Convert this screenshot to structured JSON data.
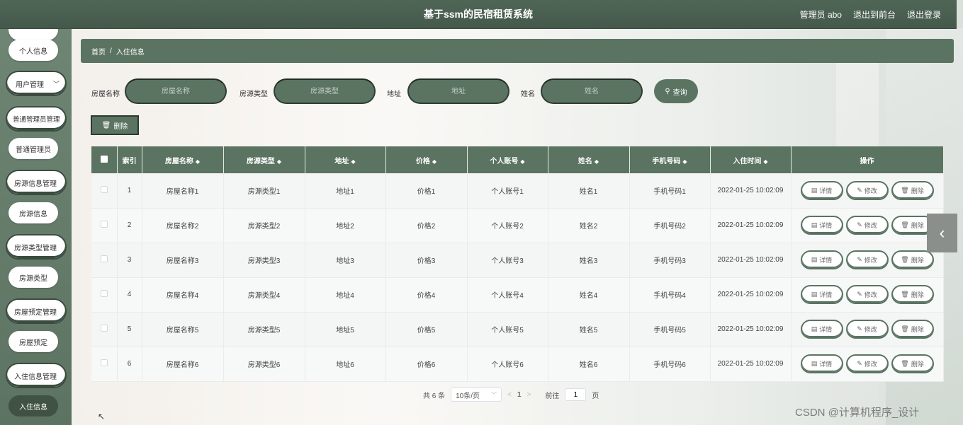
{
  "header": {
    "title": "基于ssm的民宿租赁系统",
    "admin_label": "管理员 abo",
    "to_front": "退出到前台",
    "logout": "退出登录"
  },
  "sidebar": {
    "items": [
      {
        "label": "",
        "kind": "pill"
      },
      {
        "label": "个人信息",
        "kind": "pill"
      },
      {
        "label": "用户管理",
        "kind": "group"
      },
      {
        "label": "普通管理员管理",
        "kind": "group"
      },
      {
        "label": "普通管理员",
        "kind": "pill"
      },
      {
        "label": "房源信息管理",
        "kind": "group"
      },
      {
        "label": "房源信息",
        "kind": "pill"
      },
      {
        "label": "房源类型管理",
        "kind": "group"
      },
      {
        "label": "房源类型",
        "kind": "pill"
      },
      {
        "label": "房屋预定管理",
        "kind": "group"
      },
      {
        "label": "房屋预定",
        "kind": "pill"
      },
      {
        "label": "入住信息管理",
        "kind": "group"
      },
      {
        "label": "入住信息",
        "kind": "active"
      }
    ]
  },
  "breadcrumb": {
    "home": "首页",
    "sep": "/",
    "current": "入住信息"
  },
  "search": {
    "house_label": "房屋名称",
    "house_placeholder": "房屋名称",
    "type_label": "房源类型",
    "type_placeholder": "房源类型",
    "addr_label": "地址",
    "addr_placeholder": "地址",
    "name_label": "姓名",
    "name_placeholder": "姓名",
    "query_label": "查询"
  },
  "actions": {
    "delete_label": "删除"
  },
  "table": {
    "headers": [
      "索引",
      "房屋名称",
      "房源类型",
      "地址",
      "价格",
      "个人账号",
      "姓名",
      "手机号码",
      "入住时间",
      "操作"
    ],
    "sort_mark": "◆",
    "rows": [
      [
        "1",
        "房屋名称1",
        "房源类型1",
        "地址1",
        "价格1",
        "个人账号1",
        "姓名1",
        "手机号码1",
        "2022-01-25 10:02:09"
      ],
      [
        "2",
        "房屋名称2",
        "房源类型2",
        "地址2",
        "价格2",
        "个人账号2",
        "姓名2",
        "手机号码2",
        "2022-01-25 10:02:09"
      ],
      [
        "3",
        "房屋名称3",
        "房源类型3",
        "地址3",
        "价格3",
        "个人账号3",
        "姓名3",
        "手机号码3",
        "2022-01-25 10:02:09"
      ],
      [
        "4",
        "房屋名称4",
        "房源类型4",
        "地址4",
        "价格4",
        "个人账号4",
        "姓名4",
        "手机号码4",
        "2022-01-25 10:02:09"
      ],
      [
        "5",
        "房屋名称5",
        "房源类型5",
        "地址5",
        "价格5",
        "个人账号5",
        "姓名5",
        "手机号码5",
        "2022-01-25 10:02:09"
      ],
      [
        "6",
        "房屋名称6",
        "房源类型6",
        "地址6",
        "价格6",
        "个人账号6",
        "姓名6",
        "手机号码6",
        "2022-01-25 10:02:09"
      ]
    ],
    "ops": {
      "detail": "详情",
      "edit": "修改",
      "delete": "删除"
    }
  },
  "pagination": {
    "total": "共 6 条",
    "page_size": "10条/页",
    "prev": "<",
    "current": "1",
    "next": ">",
    "goto_label": "前往",
    "goto_value": "1",
    "page_suffix": "页"
  },
  "watermark": "CSDN @计算机程序_设计",
  "colors": {
    "primary": "#5b7462",
    "header": "#4f6657",
    "sidebar": "#6f8574"
  }
}
